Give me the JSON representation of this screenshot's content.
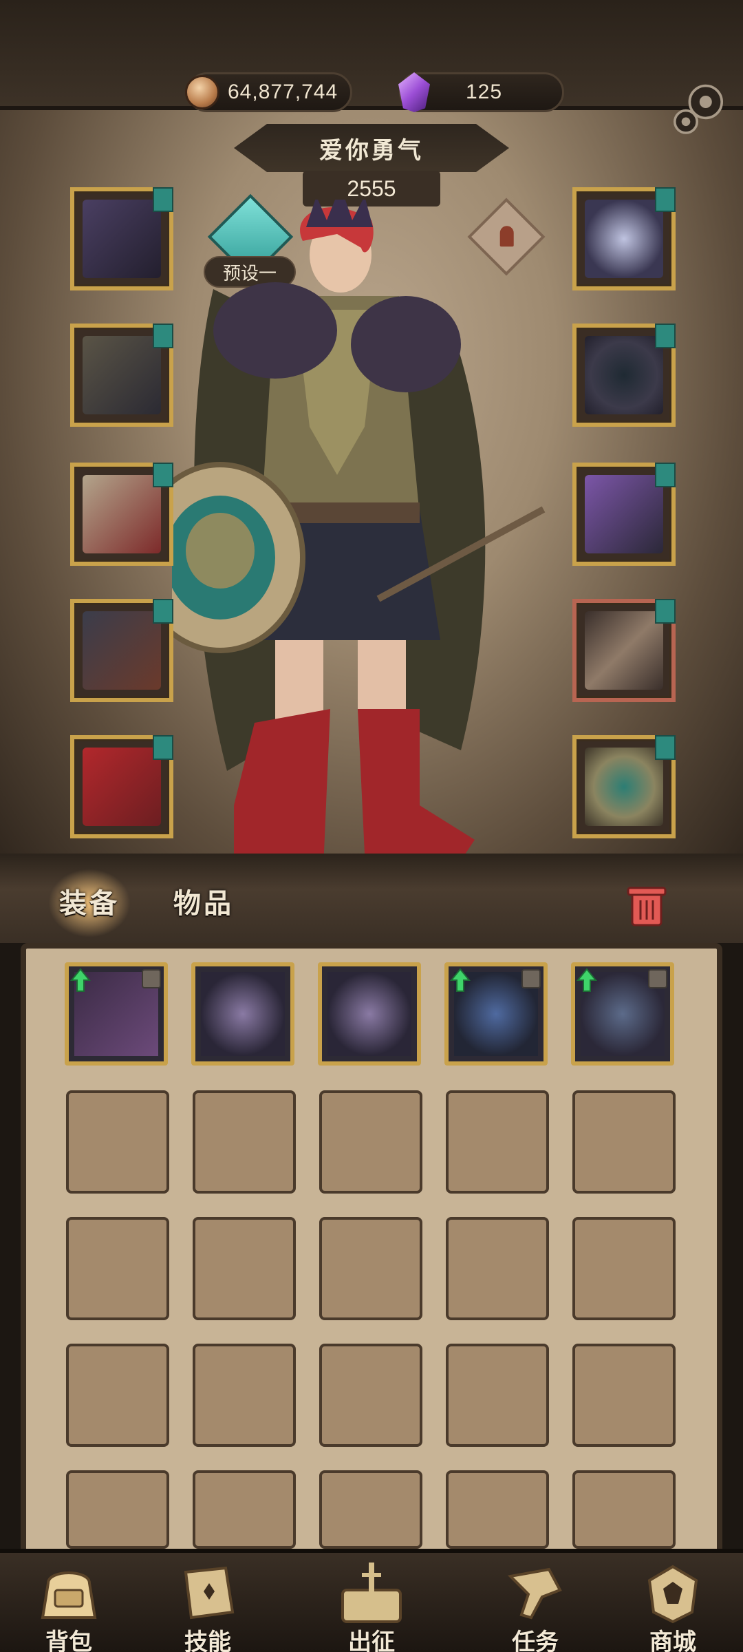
{
  "currency": {
    "coins": "64,877,744",
    "gems": "125"
  },
  "hero": {
    "name": "爱你勇气",
    "power": "2555",
    "preset_label": "预设一"
  },
  "equipment_left": [
    {
      "slot": "helmet",
      "icon": "dark-spiked-crown-icon"
    },
    {
      "slot": "armor",
      "icon": "dark-armor-icon"
    },
    {
      "slot": "gloves",
      "icon": "claw-gauntlet-icon"
    },
    {
      "slot": "pants",
      "icon": "fur-skirt-icon"
    },
    {
      "slot": "boots",
      "icon": "red-boots-icon"
    }
  ],
  "equipment_right": [
    {
      "slot": "necklace",
      "icon": "skull-pendant-icon"
    },
    {
      "slot": "ring",
      "icon": "chain-ring-icon"
    },
    {
      "slot": "bracer",
      "icon": "purple-skull-bracer-icon"
    },
    {
      "slot": "weapon",
      "icon": "bone-sword-icon"
    },
    {
      "slot": "shield",
      "icon": "skull-shield-icon"
    }
  ],
  "tabs": {
    "equipment": "装备",
    "items": "物品"
  },
  "inventory_items": [
    {
      "icon": "dark-blade-icon",
      "upgrade": true,
      "locked": true
    },
    {
      "icon": "fang-gauntlet-icon",
      "upgrade": false,
      "locked": false
    },
    {
      "icon": "fang-gauntlet-icon",
      "upgrade": false,
      "locked": false
    },
    {
      "icon": "eye-armor-icon",
      "upgrade": true,
      "locked": true
    },
    {
      "icon": "horned-mask-icon",
      "upgrade": true,
      "locked": true
    }
  ],
  "nav": {
    "backpack": "背包",
    "skills": "技能",
    "expedition": "出征",
    "quests": "任务",
    "shop": "商城"
  },
  "colors": {
    "gold_border": "#c9a24b",
    "teal_tag": "#2d8a7e",
    "panel_bg": "#c8b496",
    "upgrade_green": "#3fd46a"
  }
}
